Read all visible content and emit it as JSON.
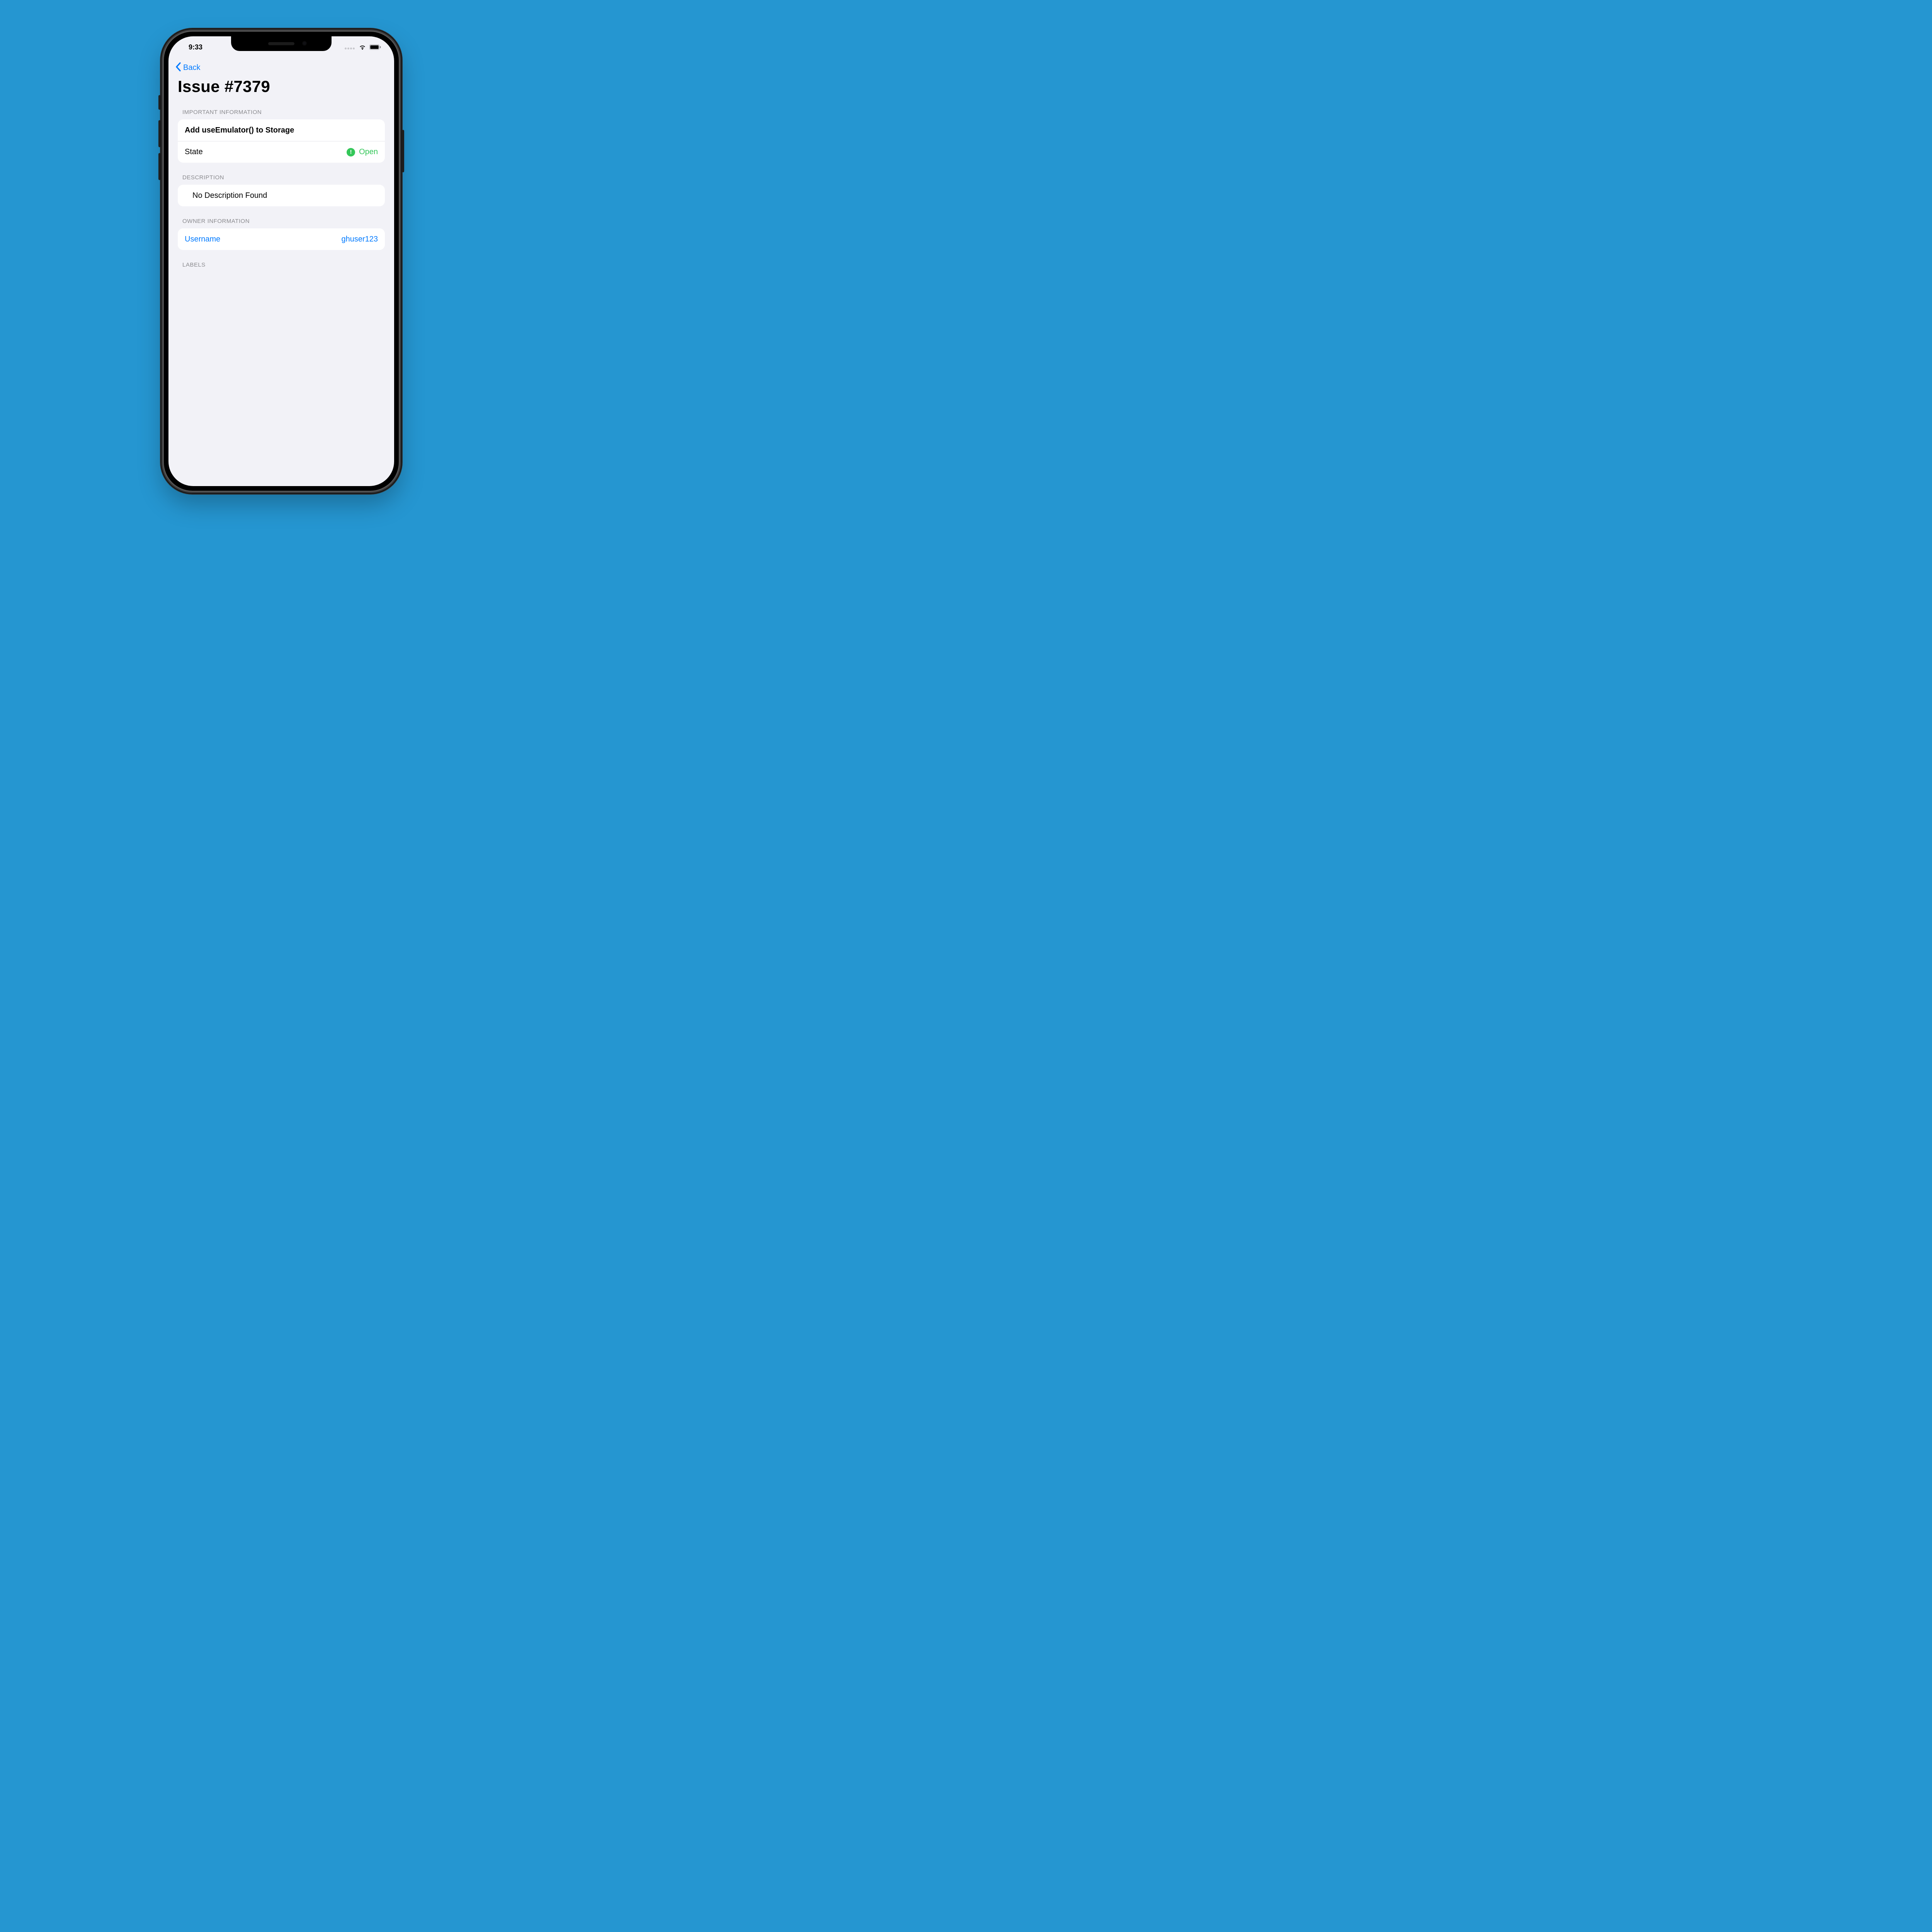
{
  "statusbar": {
    "time": "9:33"
  },
  "nav": {
    "back_label": "Back"
  },
  "title": "Issue #7379",
  "sections": {
    "important": {
      "header": "IMPORTANT INFORMATION",
      "title_row": "Add useEmulator() to Storage",
      "state_label": "State",
      "state_value": "Open"
    },
    "description": {
      "header": "DESCRIPTION",
      "body": "No Description Found"
    },
    "owner": {
      "header": "OWNER INFORMATION",
      "username_label": "Username",
      "username_value": "ghuser123"
    },
    "labels": {
      "header": "LABELS"
    }
  }
}
